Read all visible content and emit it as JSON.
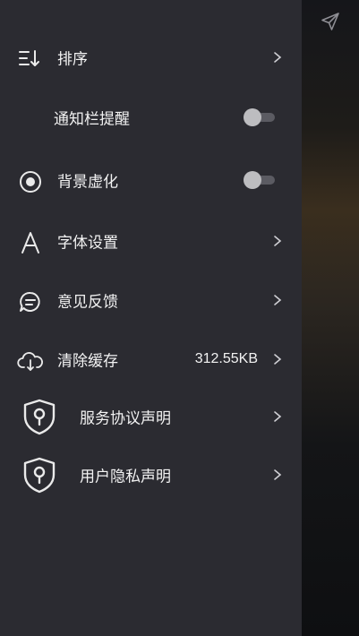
{
  "menu": {
    "sort_label": "排序",
    "notify_label": "通知栏提醒",
    "notify_on": false,
    "blur_label": "背景虚化",
    "blur_on": false,
    "font_label": "字体设置",
    "feedback_label": "意见反馈",
    "cache_label": "清除缓存",
    "cache_size": "312.55KB",
    "service_label": "服务协议声明",
    "privacy_label": "用户隐私声明"
  },
  "icons": {
    "sort": "sort-icon",
    "blur": "radio-target-icon",
    "font": "font-letter-A-icon",
    "feedback": "chat-bubble-icon",
    "cache": "cloud-download-icon",
    "service": "shield-keyhole-icon",
    "privacy": "shield-keyhole-icon",
    "share": "paper-plane-icon",
    "chevron": "chevron-right-icon"
  },
  "colors": {
    "drawer_bg": "#2b2b31",
    "text": "#f2f2f2",
    "icon": "#eaeaea",
    "toggle_track": "#5b5b62",
    "toggle_knob": "#bdbdc0"
  }
}
